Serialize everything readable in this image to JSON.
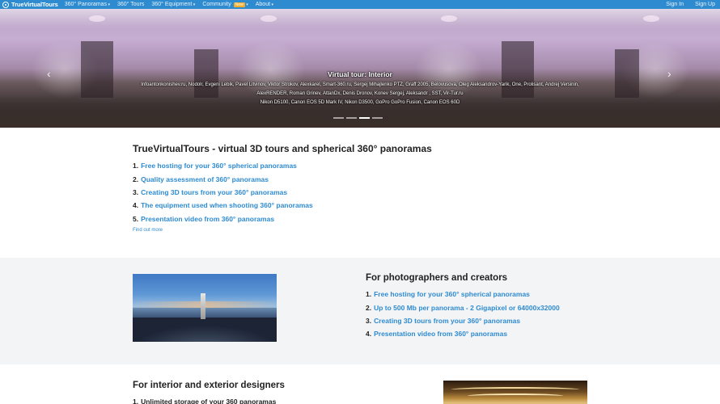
{
  "navbar": {
    "brand": "TrueVirtualTours",
    "items": [
      {
        "label": "360° Panoramas",
        "caret": true,
        "badge": ""
      },
      {
        "label": "360° Tours",
        "caret": false,
        "badge": ""
      },
      {
        "label": "360° Equipment",
        "caret": true,
        "badge": ""
      },
      {
        "label": "Community",
        "caret": true,
        "badge": "New"
      },
      {
        "label": "About",
        "caret": true,
        "badge": ""
      }
    ],
    "sign_in": "Sign In",
    "sign_up": "Sign Up"
  },
  "hero": {
    "title": "Virtual tour: Interior",
    "lines": [
      "Infoantonkonishev.ru, Nodolr, Evgeni Lebik, Pavel Litvinov, Viktor Strokov, Alexkarel, Smart-360.ru, Sergej Mihajlenko PTZ, Graff 2005, Belovusova, Oleg Aleksandrov-Yarik, One, Prolisant, Andrej Versinin,",
      "AlexRENDER, Roman Grinev, AttanDx, Denis Dronov, Konev Sergej, Aleksandr , SST, Vir-Tur.ru",
      "Nikon D5100, Canon EOS 5D Mark IV, Nikon D3500, GoPro GoPro Fusion, Canon EOS 60D"
    ],
    "prev_arrow": "‹",
    "next_arrow": "›",
    "indicator_count": 4,
    "active_indicator": 3
  },
  "intro": {
    "title": "TrueVirtualTours - virtual 3D tours and spherical 360° panoramas",
    "items": [
      {
        "num": "1.",
        "text": "Free hosting for your 360° spherical panoramas"
      },
      {
        "num": "2.",
        "text": "Quality assessment of 360° panoramas"
      },
      {
        "num": "3.",
        "text": "Creating 3D tours from your 360° panoramas"
      },
      {
        "num": "4.",
        "text": "The equipment used when shooting 360° panoramas"
      },
      {
        "num": "5.",
        "text": "Presentation video from 360° panoramas"
      }
    ],
    "find_more": "Find out more"
  },
  "photographers": {
    "title": "For photographers and creators",
    "items": [
      {
        "num": "1.",
        "text": "Free hosting for your 360° spherical panoramas"
      },
      {
        "num": "2.",
        "text": "Up to 500 Mb per panorama - 2 Gigapixel or 64000x32000"
      },
      {
        "num": "3.",
        "text": "Creating 3D tours from your 360° panoramas"
      },
      {
        "num": "4.",
        "text": "Presentation video from 360° panoramas"
      }
    ]
  },
  "designers": {
    "title": "For interior and exterior designers",
    "items": [
      {
        "num": "1.",
        "text": "Unlimited storage of your 360 panoramas"
      }
    ]
  },
  "colors": {
    "navbar": "#2e8bd0",
    "link": "#2e8bd0",
    "badge": "#f0ad2e",
    "band": "#f3f4f6"
  }
}
